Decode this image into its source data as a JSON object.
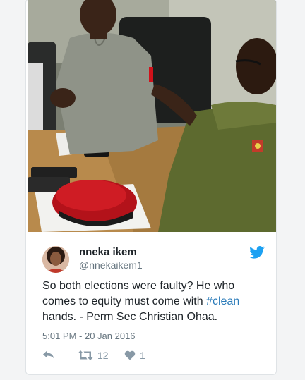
{
  "tweet": {
    "author_name": "nneka ikem",
    "author_handle": "@nnekaikem1",
    "text_before": "So both elections were faulty? He who comes to equity must come with ",
    "hashtag": "#clean",
    "text_after": " hands. - Perm Sec Christian Ohaa.",
    "timestamp": "5:01 PM - 20 Jan 2016",
    "retweet_count": "12",
    "like_count": "1"
  },
  "icons": {
    "logo": "twitter-bird-icon",
    "reply": "reply-arrow-icon",
    "retweet": "retweet-icon",
    "like": "heart-icon"
  },
  "colors": {
    "twitter_blue": "#1da1f2",
    "hashtag": "#2b7bb9",
    "muted_text": "#66757f",
    "action_icons": "#8899a6"
  }
}
